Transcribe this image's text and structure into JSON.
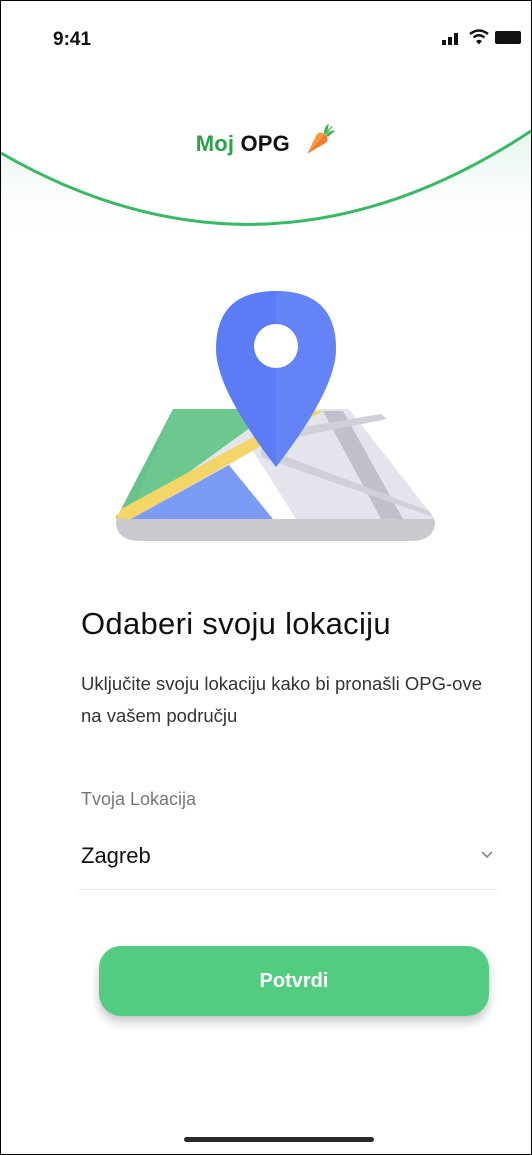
{
  "status_bar": {
    "time": "9:41"
  },
  "header": {
    "logo_part1": "Moj",
    "logo_part2": "OPG"
  },
  "main": {
    "title": "Odaberi svoju lokaciju",
    "description": "Uključite svoju lokaciju kako bi pronašli OPG-ove na vašem području"
  },
  "location_field": {
    "label": "Tvoja Lokacija",
    "value": "Zagreb"
  },
  "confirm_button": {
    "label": "Potvrdi"
  },
  "colors": {
    "brand_green": "#2aa24a",
    "button_green": "#53cc82",
    "pin_blue": "#5b7cf5"
  },
  "icons": [
    "carrot-icon",
    "signal-icon",
    "wifi-icon",
    "battery-icon",
    "map-pin-icon",
    "chevron-down-icon"
  ]
}
